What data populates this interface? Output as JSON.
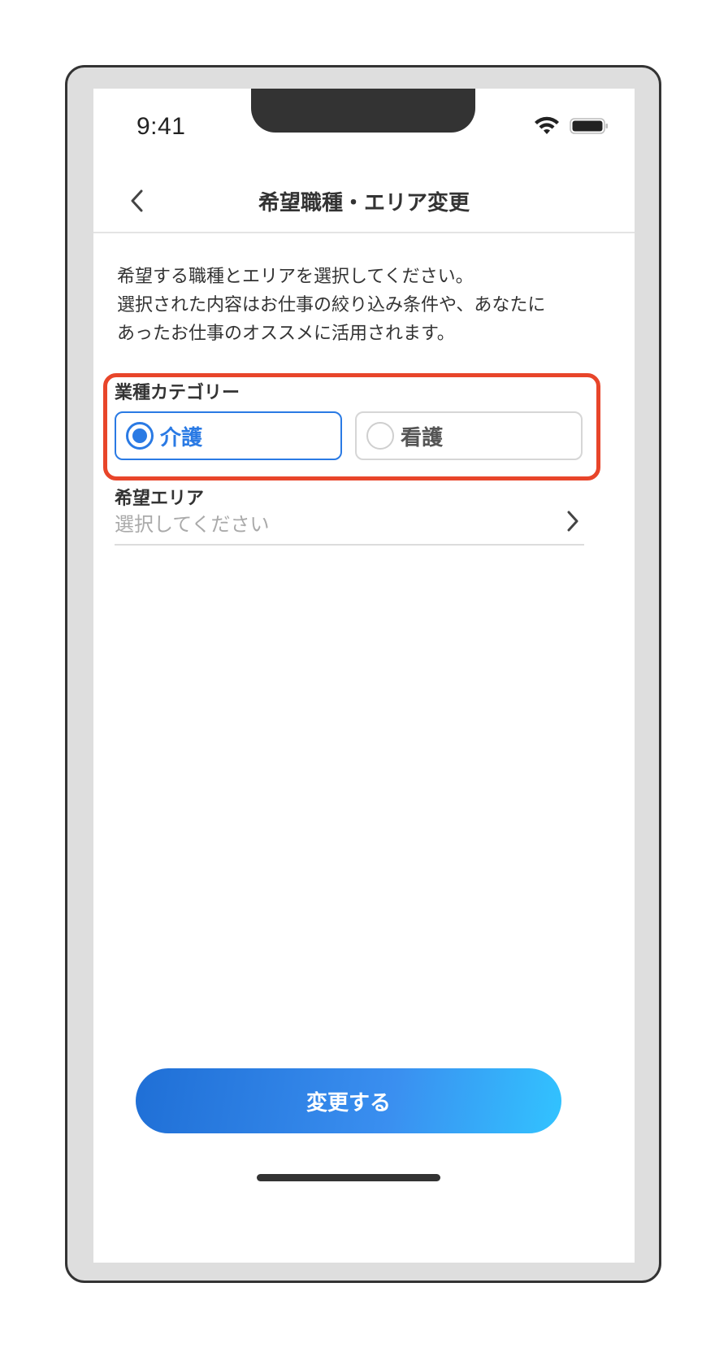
{
  "status_bar": {
    "time": "9:41",
    "wifi_icon": "wifi-icon",
    "battery_icon": "battery-icon"
  },
  "nav": {
    "back_icon": "chevron-left-icon",
    "title": "希望職種・エリア変更"
  },
  "description": {
    "lines": [
      "希望する職種とエリアを選択してください。",
      "選択された内容はお仕事の絞り込み条件や、あなたに",
      "あったお仕事のオススメに活用されます。"
    ]
  },
  "category": {
    "label": "業種カテゴリー",
    "options": [
      {
        "label": "介護",
        "selected": true
      },
      {
        "label": "看護",
        "selected": false
      }
    ],
    "highlight_color": "#e8452a"
  },
  "area": {
    "label": "希望エリア",
    "placeholder": "選択してください",
    "chevron_icon": "chevron-right-icon"
  },
  "submit": {
    "label": "変更する"
  },
  "colors": {
    "accent": "#2a7ae4",
    "button_gradient_start": "#1f6fd6",
    "button_gradient_end": "#32c3ff"
  }
}
